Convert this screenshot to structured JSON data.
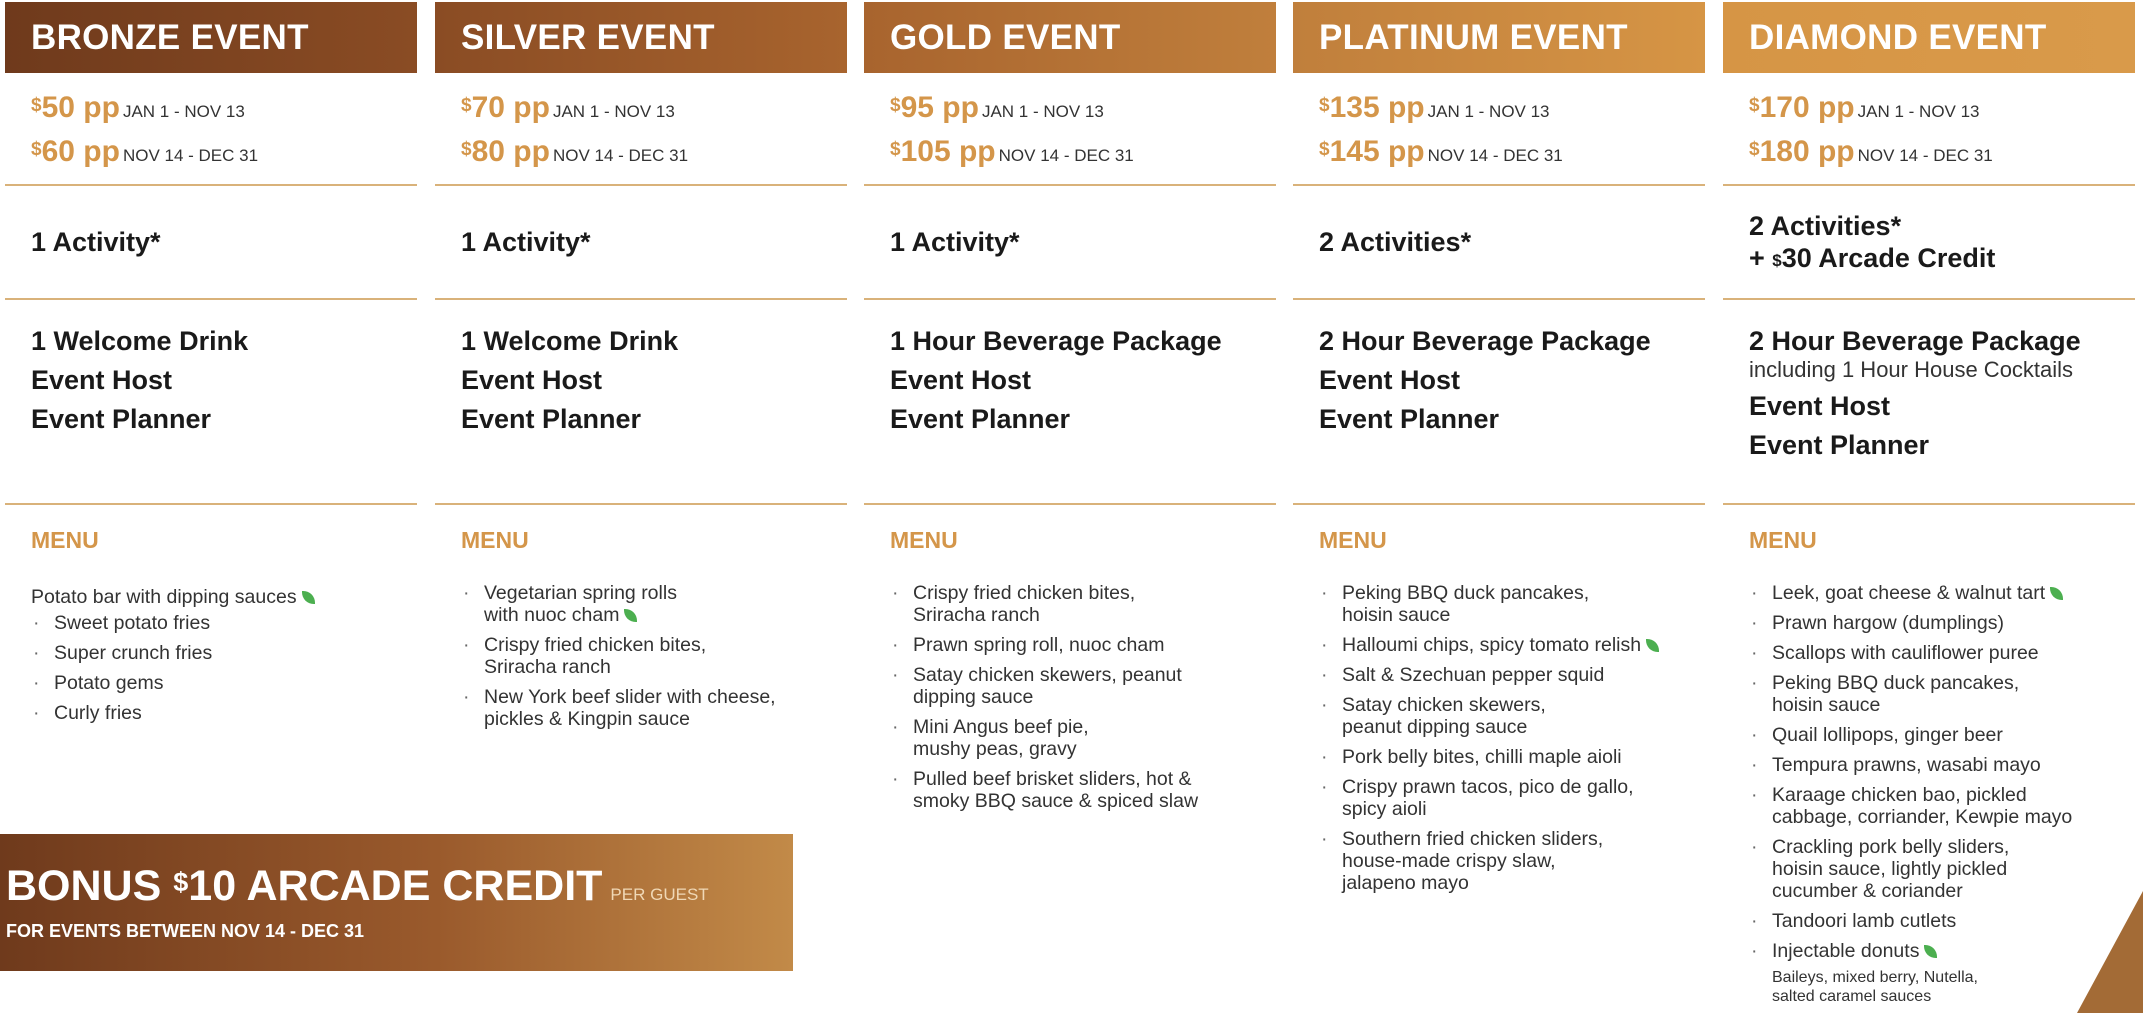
{
  "currency_symbol": "$",
  "per_person": "pp",
  "menu_label": "MENU",
  "colors": {
    "accent": "#d4964a",
    "leaf": "#4caf50"
  },
  "packages": [
    {
      "title": "BRONZE EVENT",
      "header_gradient": [
        "#6f3a1c",
        "#8a4c24"
      ],
      "prices": [
        {
          "amount": "50",
          "dates": "JAN 1 - NOV 13"
        },
        {
          "amount": "60",
          "dates": "NOV 14 - DEC 31"
        }
      ],
      "activities": "1 Activity*",
      "activities_extra": "",
      "inclusions": [
        "1 Welcome Drink",
        "Event Host",
        "Event Planner"
      ],
      "inclusion_note": "",
      "menu_lead": "Potato bar with dipping sauces",
      "menu_items": [
        "Sweet potato fries",
        "Super crunch fries",
        "Potato gems",
        "Curly fries"
      ]
    },
    {
      "title": "SILVER EVENT",
      "header_gradient": [
        "#8a4c24",
        "#a8642e"
      ],
      "prices": [
        {
          "amount": "70",
          "dates": "JAN 1 - NOV 13"
        },
        {
          "amount": "80",
          "dates": "NOV 14 - DEC 31"
        }
      ],
      "activities": "1 Activity*",
      "activities_extra": "",
      "inclusions": [
        "1 Welcome Drink",
        "Event Host",
        "Event Planner"
      ],
      "inclusion_note": "",
      "menu_lead": "",
      "menu_items": [
        "Vegetarian spring rolls\nwith nuoc cham",
        "Crispy fried chicken bites,\nSriracha ranch",
        "New York beef slider with cheese,\npickles & Kingpin sauce"
      ]
    },
    {
      "title": "GOLD EVENT",
      "header_gradient": [
        "#a8642e",
        "#c07f3c"
      ],
      "prices": [
        {
          "amount": "95",
          "dates": "JAN 1 - NOV 13"
        },
        {
          "amount": "105",
          "dates": "NOV 14 - DEC 31"
        }
      ],
      "activities": "1 Activity*",
      "activities_extra": "",
      "inclusions": [
        "1 Hour Beverage Package",
        "Event Host",
        "Event Planner"
      ],
      "inclusion_note": "",
      "menu_lead": "",
      "menu_items": [
        "Crispy fried chicken bites,\nSriracha ranch",
        "Prawn spring roll, nuoc cham",
        "Satay chicken skewers, peanut\ndipping sauce",
        "Mini Angus beef pie,\nmushy peas, gravy",
        "Pulled beef brisket sliders, hot &\nsmoky BBQ sauce & spiced slaw"
      ]
    },
    {
      "title": "PLATINUM EVENT",
      "header_gradient": [
        "#c07f3c",
        "#d69545"
      ],
      "prices": [
        {
          "amount": "135",
          "dates": "JAN 1 - NOV 13"
        },
        {
          "amount": "145",
          "dates": "NOV 14 - DEC 31"
        }
      ],
      "activities": "2 Activities*",
      "activities_extra": "",
      "inclusions": [
        "2 Hour Beverage Package",
        "Event Host",
        "Event Planner"
      ],
      "inclusion_note": "",
      "menu_lead": "",
      "menu_items": [
        "Peking BBQ duck pancakes,\nhoisin sauce",
        "Halloumi chips, spicy tomato relish",
        "Salt & Szechuan pepper squid",
        "Satay chicken skewers,\npeanut dipping sauce",
        "Pork belly bites, chilli maple aioli",
        "Crispy prawn tacos, pico de gallo,\nspicy aioli",
        "Southern fried chicken sliders,\nhouse-made crispy slaw,\njalapeno mayo"
      ]
    },
    {
      "title": "DIAMOND EVENT",
      "header_gradient": [
        "#d69545",
        "#d99a4a"
      ],
      "prices": [
        {
          "amount": "170",
          "dates": "JAN 1 - NOV 13"
        },
        {
          "amount": "180",
          "dates": "NOV 14 - DEC 31"
        }
      ],
      "activities": "2 Activities*",
      "activities_extra": "30 Arcade Credit",
      "inclusions": [
        "2 Hour Beverage Package",
        "Event Host",
        "Event Planner"
      ],
      "inclusion_note": "including 1 Hour House Cocktails",
      "menu_lead": "",
      "menu_items": [
        "Leek, goat cheese & walnut tart",
        "Prawn hargow (dumplings)",
        "Scallops with cauliflower puree",
        "Peking BBQ duck pancakes,\nhoisin sauce",
        "Quail lollipops, ginger beer",
        "Tempura prawns, wasabi mayo",
        "Karaage chicken bao, pickled\ncabbage, corriander, Kewpie mayo",
        "Crackling pork belly sliders,\nhoisin sauce, lightly pickled\ncucumber & coriander",
        "Tandoori lamb cutlets",
        "Injectable donuts"
      ],
      "menu_note": "Baileys, mixed berry, Nutella,\nsalted caramel sauces"
    }
  ],
  "leaf_items": {
    "0": [
      "lead"
    ],
    "1": [
      0
    ],
    "3": [
      1
    ],
    "4": [
      0,
      9
    ]
  },
  "bonus": {
    "title_pre": "BONUS",
    "title_amount": "10 ARCADE CREDIT",
    "per_guest": "PER GUEST",
    "subtitle": "FOR EVENTS BETWEEN NOV 14 - DEC 31"
  }
}
